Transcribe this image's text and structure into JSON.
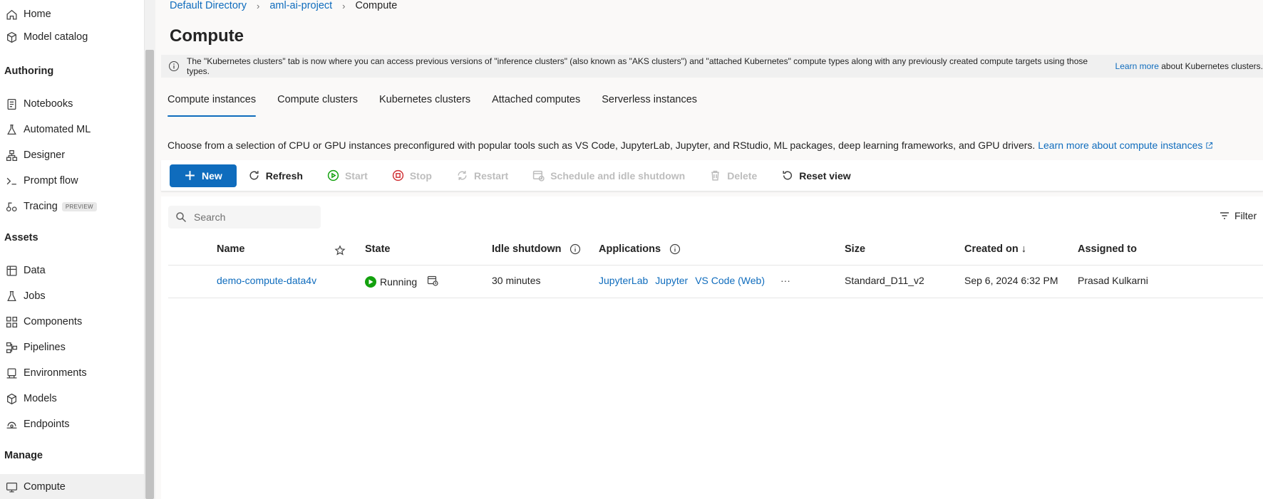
{
  "sidebar": {
    "top_items": [
      {
        "label": "Home",
        "icon": "home-icon"
      },
      {
        "label": "Model catalog",
        "icon": "cube-icon"
      }
    ],
    "sections": [
      {
        "heading": "Authoring",
        "items": [
          {
            "label": "Notebooks",
            "icon": "notebook-icon"
          },
          {
            "label": "Automated ML",
            "icon": "flask-icon"
          },
          {
            "label": "Designer",
            "icon": "designer-icon"
          },
          {
            "label": "Prompt flow",
            "icon": "prompt-icon"
          },
          {
            "label": "Tracing",
            "icon": "tracing-icon",
            "badge": "PREVIEW"
          }
        ]
      },
      {
        "heading": "Assets",
        "items": [
          {
            "label": "Data",
            "icon": "data-icon"
          },
          {
            "label": "Jobs",
            "icon": "jobs-icon"
          },
          {
            "label": "Components",
            "icon": "components-icon"
          },
          {
            "label": "Pipelines",
            "icon": "pipelines-icon"
          },
          {
            "label": "Environments",
            "icon": "environments-icon"
          },
          {
            "label": "Models",
            "icon": "models-icon"
          },
          {
            "label": "Endpoints",
            "icon": "endpoints-icon"
          }
        ]
      },
      {
        "heading": "Manage",
        "items": [
          {
            "label": "Compute",
            "icon": "compute-icon",
            "active": true
          }
        ]
      }
    ]
  },
  "breadcrumb": {
    "items": [
      "Default Directory",
      "aml-ai-project"
    ],
    "current": "Compute"
  },
  "page": {
    "title": "Compute"
  },
  "info_bar": {
    "text": "The \"Kubernetes clusters\" tab is now where you can access previous versions of \"inference clusters\" (also known as \"AKS clusters\") and \"attached Kubernetes\" compute types along with any previously created compute targets using those types.",
    "link": "Learn more",
    "suffix": "about Kubernetes clusters."
  },
  "tabs": [
    {
      "label": "Compute instances",
      "active": true
    },
    {
      "label": "Compute clusters"
    },
    {
      "label": "Kubernetes clusters"
    },
    {
      "label": "Attached computes"
    },
    {
      "label": "Serverless instances"
    }
  ],
  "description": {
    "text": "Choose from a selection of CPU or GPU instances preconfigured with popular tools such as VS Code, JupyterLab, Jupyter, and RStudio, ML packages, deep learning frameworks, and GPU drivers.",
    "link": "Learn more about compute instances"
  },
  "toolbar": {
    "new": "New",
    "refresh": "Refresh",
    "start": "Start",
    "stop": "Stop",
    "restart": "Restart",
    "schedule": "Schedule and idle shutdown",
    "delete": "Delete",
    "reset_view": "Reset view"
  },
  "grid": {
    "search_placeholder": "Search",
    "filter": "Filter",
    "columns": {
      "name": "Name",
      "state": "State",
      "idle_shutdown": "Idle shutdown",
      "applications": "Applications",
      "size": "Size",
      "created_on": "Created on ↓",
      "assigned_to": "Assigned to"
    },
    "rows": [
      {
        "name": "demo-compute-data4v",
        "state": "Running",
        "idle_shutdown": "30 minutes",
        "applications": [
          "JupyterLab",
          "Jupyter",
          "VS Code (Web)"
        ],
        "more": "···",
        "size": "Standard_D11_v2",
        "created_on": "Sep 6, 2024 6:32 PM",
        "assigned_to": "Prasad Kulkarni"
      }
    ]
  },
  "colors": {
    "accent": "#0f6cbd",
    "running": "#13a10e"
  }
}
